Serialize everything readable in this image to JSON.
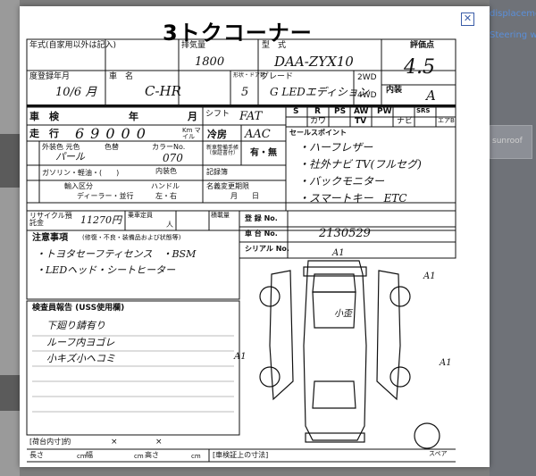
{
  "background": {
    "links": [
      "displacement",
      "Steering whee"
    ],
    "box_text": "sunroof"
  },
  "modal": {
    "close_icon": "close-icon"
  },
  "sheet": {
    "title": "3トクコーナー",
    "top": {
      "year_label": "年式(自家用以外は記入)",
      "displacement_label": "排気量",
      "displacement_value": "1800",
      "model_label": "型　式",
      "model_value": "DAA-ZYX10",
      "score_label": "評価点",
      "score_value": "4.5",
      "registration_label": "度登録年月",
      "registration_value": "10/6 月",
      "name_label": "車　名",
      "name_value": "C-HR",
      "doors_label": "形状・ドア数",
      "doors_value": "5",
      "grade_label": "グレード",
      "grade_value": "G LEDエディション",
      "drive_2wd": "2WD",
      "drive_4wd": "4WD",
      "interior_label": "内装",
      "interior_value": "A"
    },
    "mid": {
      "inspection_label": "車　検",
      "year_unit": "年",
      "month_unit": "月",
      "shift_label": "シフト",
      "shift_value": "FAT",
      "mileage_label": "走　行",
      "mileage_value": "69000",
      "mileage_unit": "Km マイル",
      "ac_label": "冷房",
      "ac_value": "AAC",
      "features": [
        "S",
        "R",
        "PS",
        "AW",
        "PW",
        "カワ",
        "TV",
        "ナビ",
        "SRS",
        "エアB"
      ],
      "body_color_label": "外装色 元色",
      "body_color_value": "パール",
      "color_label": "色替",
      "color_no_label": "カラーNo.",
      "color_no_value": "070",
      "fuel_label": "燃料",
      "fuel_options": "ガソリン・軽油・(　　)",
      "interior_color_label": "内装色",
      "manual_label": "新車整備手帳（保証書付）",
      "manual_value": "有・無",
      "record_label": "記録簿",
      "record_value": "",
      "import_label": "輸入",
      "import_type_label": "輸入区分",
      "import_type_value": "ディーラー・並行",
      "handle_label": "ハンドル",
      "handle_value": "左・右",
      "title_change_label": "名義変更期限",
      "title_change_value": "月　　日",
      "recycle_label": "リサイクル預託金",
      "recycle_value": "11270円",
      "capacity_label": "乗車定員",
      "capacity_unit": "人",
      "load_label": "積載量",
      "load_unit": "kg"
    },
    "selling_points": {
      "label": "セールスポイント",
      "items": [
        "・ハーフレザー",
        "・社外ナビ TV(フルセグ)",
        "・バックモニター",
        "・スマートキー　ETC"
      ]
    },
    "registry": {
      "reg_no_label": "登 録 No.",
      "chassis_label": "車 台 No.",
      "chassis_value": "2130529",
      "serial_label": "シリアル No."
    },
    "notes": {
      "label": "注意事項",
      "label_note": "(修復・不良・装備品および状態等)",
      "lines": [
        "・トヨタセーフティセンス　・BSM",
        "・LEDヘッド・シートヒーター"
      ]
    },
    "inspector": {
      "label": "検査員報告 (USS使用欄)",
      "lines": [
        "下廻り錆有り",
        "ルーフ内ヨゴレ",
        "小キズ小ヘコミ"
      ]
    },
    "diagram": {
      "marks": [
        "A1",
        "A1",
        "A1",
        "小歪",
        "A1"
      ],
      "spare_label": "スペア"
    },
    "bottom": {
      "cargo_label": "[荷台内寸]約",
      "times1": "×",
      "times2": "×",
      "length_label": "長さ",
      "width_label": "幅",
      "height_label": "高さ",
      "cm": "cm",
      "cert_label": "[車検証上の寸法]"
    }
  }
}
